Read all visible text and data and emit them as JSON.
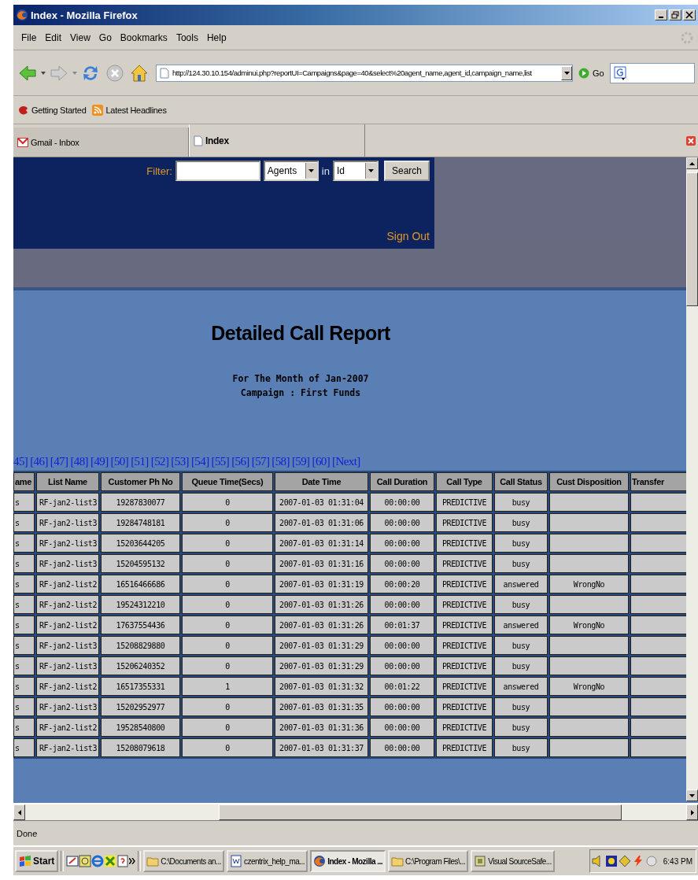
{
  "window": {
    "title": "Index - Mozilla Firefox"
  },
  "menu": [
    "File",
    "Edit",
    "View",
    "Go",
    "Bookmarks",
    "Tools",
    "Help"
  ],
  "toolbar": {
    "url": "http://124.30.10.154/adminui.php?reportUI=Campaigns&page=40&select%20agent_name,agent_id,campaign_name,list",
    "go_label": "Go"
  },
  "bookmarks": [
    "Getting Started",
    "Latest Headlines"
  ],
  "tabs": [
    {
      "label": "Gmail - Inbox",
      "selected": false
    },
    {
      "label": "Index",
      "selected": true
    }
  ],
  "header": {
    "filter_label": "Filter:",
    "filter_select": "Agents",
    "in_label": "in",
    "field_select": "Id",
    "search_button": "Search",
    "sign_out": "Sign Out"
  },
  "report": {
    "title": "Detailed Call Report",
    "month": "For The Month of Jan-2007",
    "campaign": "Campaign : First Funds"
  },
  "pagination": [
    "45]",
    "[46]",
    "[47]",
    "[48]",
    "[49]",
    "[50]",
    "[51]",
    "[52]",
    "[53]",
    "[54]",
    "[55]",
    "[56]",
    "[57]",
    "[58]",
    "[59]",
    "[60]",
    "[Next]"
  ],
  "table": {
    "columns": [
      "ame",
      "List Name",
      "Customer Ph No",
      "Queue Time(Secs)",
      "Date Time",
      "Call Duration",
      "Call Type",
      "Call Status",
      "Cust Disposition",
      "Transfer"
    ],
    "rows": [
      {
        "column_1": "s",
        "list_name": "RF-jan2-list3",
        "customer_ph_no": "19287830077",
        "queue_time": "0",
        "date_time": "2007-01-03 01:31:04",
        "call_duration": "00:00:00",
        "call_type": "PREDICTIVE",
        "call_status": "busy"
      },
      {
        "column_1": "s",
        "list_name": "RF-jan2-list3",
        "customer_ph_no": "19284748181",
        "queue_time": "0",
        "date_time": "2007-01-03 01:31:06",
        "call_duration": "00:00:00",
        "call_type": "PREDICTIVE",
        "call_status": "busy"
      },
      {
        "column_1": "s",
        "list_name": "RF-jan2-list3",
        "customer_ph_no": "15203644205",
        "queue_time": "0",
        "date_time": "2007-01-03 01:31:14",
        "call_duration": "00:00:00",
        "call_type": "PREDICTIVE",
        "call_status": "busy"
      },
      {
        "column_1": "s",
        "list_name": "RF-jan2-list3",
        "customer_ph_no": "15204595132",
        "queue_time": "0",
        "date_time": "2007-01-03 01:31:16",
        "call_duration": "00:00:00",
        "call_type": "PREDICTIVE",
        "call_status": "busy"
      },
      {
        "column_1": "s",
        "list_name": "RF-jan2-list2",
        "customer_ph_no": "16516466686",
        "queue_time": "0",
        "date_time": "2007-01-03 01:31:19",
        "call_duration": "00:00:20",
        "call_type": "PREDICTIVE",
        "call_status": "answered",
        "cust_disposition": "WrongNo"
      },
      {
        "column_1": "s",
        "list_name": "RF-jan2-list2",
        "customer_ph_no": "19524312210",
        "queue_time": "0",
        "date_time": "2007-01-03 01:31:26",
        "call_duration": "00:00:00",
        "call_type": "PREDICTIVE",
        "call_status": "busy"
      },
      {
        "column_1": "s",
        "list_name": "RF-jan2-list2",
        "customer_ph_no": "17637554436",
        "queue_time": "0",
        "date_time": "2007-01-03 01:31:26",
        "call_duration": "00:01:37",
        "call_type": "PREDICTIVE",
        "call_status": "answered",
        "cust_disposition": "WrongNo"
      },
      {
        "column_1": "s",
        "list_name": "RF-jan2-list3",
        "customer_ph_no": "15208829880",
        "queue_time": "0",
        "date_time": "2007-01-03 01:31:29",
        "call_duration": "00:00:00",
        "call_type": "PREDICTIVE",
        "call_status": "busy"
      },
      {
        "column_1": "s",
        "list_name": "RF-jan2-list3",
        "customer_ph_no": "15206240352",
        "queue_time": "0",
        "date_time": "2007-01-03 01:31:29",
        "call_duration": "00:00:00",
        "call_type": "PREDICTIVE",
        "call_status": "busy"
      },
      {
        "column_1": "s",
        "list_name": "RF-jan2-list2",
        "customer_ph_no": "16517355331",
        "queue_time": "1",
        "date_time": "2007-01-03 01:31:32",
        "call_duration": "00:01:22",
        "call_type": "PREDICTIVE",
        "call_status": "answered",
        "cust_disposition": "WrongNo"
      },
      {
        "column_1": "s",
        "list_name": "RF-jan2-list3",
        "customer_ph_no": "15202952977",
        "queue_time": "0",
        "date_time": "2007-01-03 01:31:35",
        "call_duration": "00:00:00",
        "call_type": "PREDICTIVE",
        "call_status": "busy"
      },
      {
        "column_1": "s",
        "list_name": "RF-jan2-list2",
        "customer_ph_no": "19528540800",
        "queue_time": "0",
        "date_time": "2007-01-03 01:31:36",
        "call_duration": "00:00:00",
        "call_type": "PREDICTIVE",
        "call_status": "busy"
      },
      {
        "column_1": "s",
        "list_name": "RF-jan2-list3",
        "customer_ph_no": "15208079618",
        "queue_time": "0",
        "date_time": "2007-01-03 01:31:37",
        "call_duration": "00:00:00",
        "call_type": "PREDICTIVE",
        "call_status": "busy"
      }
    ]
  },
  "status_bar": "Done",
  "taskbar": {
    "start": "Start",
    "buttons": [
      {
        "label": "C:\\Documents an...",
        "selected": false
      },
      {
        "label": "czentrix_help_ma...",
        "selected": false
      },
      {
        "label": "Index - Mozilla ...",
        "selected": true
      },
      {
        "label": "C:\\Program Files\\...",
        "selected": false
      },
      {
        "label": "Visual SourceSafe...",
        "selected": false
      }
    ],
    "clock": "6:43 PM"
  }
}
